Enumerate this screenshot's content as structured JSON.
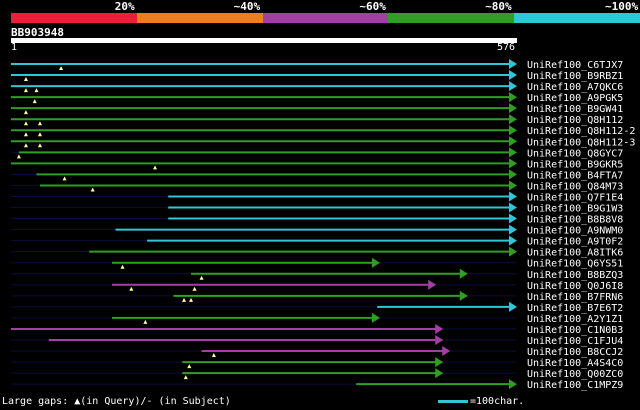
{
  "legend": {
    "segments": [
      {
        "label": "20%",
        "color": "#e8203a"
      },
      {
        "label": "~40%",
        "color": "#ef7d1e"
      },
      {
        "label": "~60%",
        "color": "#a63ca6"
      },
      {
        "label": "~80%",
        "color": "#2e9f22"
      },
      {
        "label": "~100%",
        "color": "#2fc6d6"
      }
    ]
  },
  "query": {
    "name": "BB903948",
    "start": "1",
    "end": "576"
  },
  "hits": [
    {
      "name": "UniRef100_C6TJX7",
      "color": "#2fc6d6",
      "start": 1,
      "end": 576,
      "gaps": [
        58
      ]
    },
    {
      "name": "UniRef100_B9RBZ1",
      "color": "#2fc6d6",
      "start": 1,
      "end": 576,
      "gaps": [
        18
      ]
    },
    {
      "name": "UniRef100_A7QKC6",
      "color": "#2fc6d6",
      "start": 1,
      "end": 576,
      "gaps": [
        18,
        30
      ]
    },
    {
      "name": "UniRef100_A9PGK5",
      "color": "#2e9f22",
      "start": 1,
      "end": 576,
      "gaps": [
        28
      ]
    },
    {
      "name": "UniRef100_B9GW41",
      "color": "#2e9f22",
      "start": 1,
      "end": 576,
      "gaps": [
        18
      ]
    },
    {
      "name": "UniRef100_Q8H112",
      "color": "#2e9f22",
      "start": 1,
      "end": 576,
      "gaps": [
        18,
        34
      ]
    },
    {
      "name": "UniRef100_Q8H112-2",
      "color": "#2e9f22",
      "start": 1,
      "end": 576,
      "gaps": [
        18,
        34
      ]
    },
    {
      "name": "UniRef100_Q8H112-3",
      "color": "#2e9f22",
      "start": 1,
      "end": 576,
      "gaps": [
        18,
        34
      ]
    },
    {
      "name": "UniRef100_Q8GYC7",
      "color": "#2e9f22",
      "start": 10,
      "end": 576,
      "gaps": [
        10
      ]
    },
    {
      "name": "UniRef100_B9GKR5",
      "color": "#2e9f22",
      "start": 1,
      "end": 576,
      "gaps": [
        165
      ]
    },
    {
      "name": "UniRef100_B4FTA7",
      "color": "#2e9f22",
      "start": 30,
      "end": 576,
      "gaps": [
        62
      ]
    },
    {
      "name": "UniRef100_Q84M73",
      "color": "#2e9f22",
      "start": 34,
      "end": 576,
      "gaps": [
        94
      ]
    },
    {
      "name": "UniRef100_Q7F1E4",
      "color": "#2fc6d6",
      "start": 180,
      "end": 576,
      "gaps": []
    },
    {
      "name": "UniRef100_B9G1W3",
      "color": "#2fc6d6",
      "start": 180,
      "end": 576,
      "gaps": []
    },
    {
      "name": "UniRef100_B8B8V8",
      "color": "#2fc6d6",
      "start": 180,
      "end": 576,
      "gaps": []
    },
    {
      "name": "UniRef100_A9NWM0",
      "color": "#2fc6d6",
      "start": 120,
      "end": 576,
      "gaps": []
    },
    {
      "name": "UniRef100_A9T0F2",
      "color": "#2fc6d6",
      "start": 156,
      "end": 576,
      "gaps": []
    },
    {
      "name": "UniRef100_A8ITK6",
      "color": "#2e9f22",
      "start": 90,
      "end": 576,
      "gaps": []
    },
    {
      "name": "UniRef100_Q6YS51",
      "color": "#2e9f22",
      "start": 116,
      "end": 420,
      "gaps": [
        128
      ]
    },
    {
      "name": "UniRef100_B8BZQ3",
      "color": "#2e9f22",
      "start": 206,
      "end": 520,
      "gaps": [
        218
      ]
    },
    {
      "name": "UniRef100_Q0J6I8",
      "color": "#a63ca6",
      "start": 116,
      "end": 484,
      "gaps": [
        138,
        210
      ]
    },
    {
      "name": "UniRef100_B7FRN6",
      "color": "#2e9f22",
      "start": 186,
      "end": 520,
      "gaps": [
        198,
        206
      ]
    },
    {
      "name": "UniRef100_B7E6T2",
      "color": "#2fc6d6",
      "start": 418,
      "end": 576,
      "gaps": []
    },
    {
      "name": "UniRef100_A2Y1Z1",
      "color": "#2e9f22",
      "start": 116,
      "end": 420,
      "gaps": [
        154
      ]
    },
    {
      "name": "UniRef100_C1N0B3",
      "color": "#a63ca6",
      "start": 1,
      "end": 492,
      "gaps": []
    },
    {
      "name": "UniRef100_C1FJU4",
      "color": "#a63ca6",
      "start": 44,
      "end": 492,
      "gaps": []
    },
    {
      "name": "UniRef100_B8CCJ2",
      "color": "#a63ca6",
      "start": 218,
      "end": 500,
      "gaps": [
        232
      ]
    },
    {
      "name": "UniRef100_A4S4C0",
      "color": "#2e9f22",
      "start": 196,
      "end": 492,
      "gaps": [
        204
      ]
    },
    {
      "name": "UniRef100_Q00ZC0",
      "color": "#2e9f22",
      "start": 196,
      "end": 492,
      "gaps": [
        200
      ]
    },
    {
      "name": "UniRef100_C1MPZ9",
      "color": "#2e9f22",
      "start": 394,
      "end": 576,
      "gaps": []
    }
  ],
  "footer": {
    "gaps_label": "Large gaps: ▲(in Query)/- (in Subject)",
    "scale_label": "=100char."
  }
}
